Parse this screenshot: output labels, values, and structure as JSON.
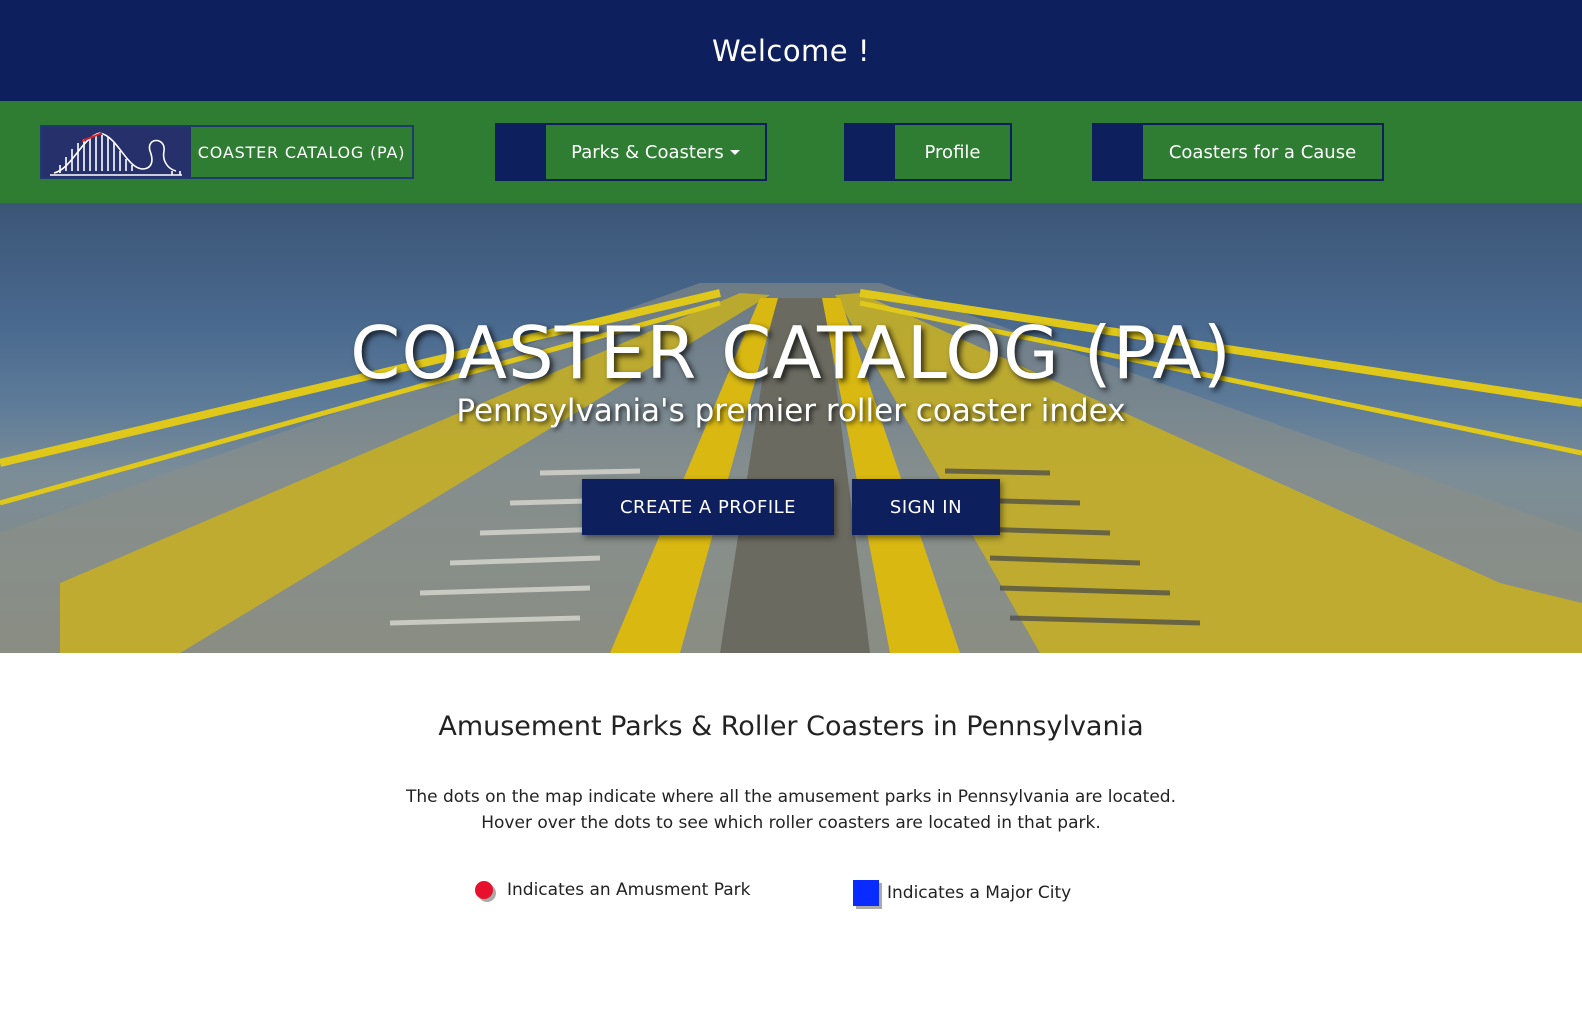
{
  "header": {
    "welcome": "Welcome !"
  },
  "nav": {
    "brand": "COASTER CATALOG (PA)",
    "items": [
      {
        "label": "Parks & Coasters"
      },
      {
        "label": "Profile"
      },
      {
        "label": "Coasters for a Cause"
      }
    ]
  },
  "hero": {
    "title": "COASTER CATALOG (PA)",
    "subtitle": "Pennsylvania's premier roller coaster index",
    "create_label": "CREATE A PROFILE",
    "signin_label": "SIGN IN"
  },
  "main": {
    "heading": "Amusement Parks & Roller Coasters in Pennsylvania",
    "desc_line1": "The dots on the map indicate where all the amusement parks in Pennsylvania are located.",
    "desc_line2": "Hover over the dots to see which roller coasters are located in that park.",
    "legend": [
      {
        "label": "Indicates an Amusment Park",
        "color": "#e8112d"
      },
      {
        "label": "Indicates a Major City",
        "color": "#0a2bff"
      }
    ]
  },
  "colors": {
    "navy": "#0e1f5e",
    "green": "#2e7d32"
  }
}
